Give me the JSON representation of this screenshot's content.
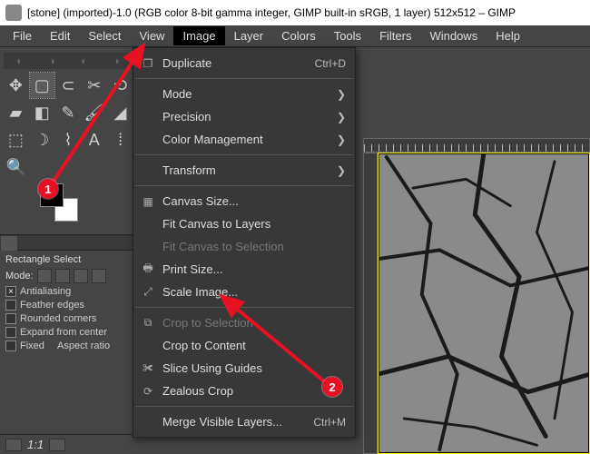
{
  "titlebar": {
    "text": "[stone] (imported)-1.0 (RGB color 8-bit gamma integer, GIMP built-in sRGB, 1 layer) 512x512 – GIMP"
  },
  "menubar": {
    "items": [
      "File",
      "Edit",
      "Select",
      "View",
      "Image",
      "Layer",
      "Colors",
      "Tools",
      "Filters",
      "Windows",
      "Help"
    ],
    "active": "Image"
  },
  "toolopts": {
    "title": "Rectangle Select",
    "mode_label": "Mode:",
    "antialiasing": "Antialiasing",
    "feather": "Feather edges",
    "rounded": "Rounded corners",
    "expand": "Expand from center",
    "fixed": "Fixed",
    "fixed_value": "Aspect ratio"
  },
  "status": {
    "zoom": "1:1"
  },
  "dropdown": {
    "duplicate": "Duplicate",
    "duplicate_accel": "Ctrl+D",
    "mode": "Mode",
    "precision": "Precision",
    "color_mgmt": "Color Management",
    "transform": "Transform",
    "canvas_size": "Canvas Size...",
    "fit_layers": "Fit Canvas to Layers",
    "fit_sel": "Fit Canvas to Selection",
    "print_size": "Print Size...",
    "scale": "Scale Image...",
    "crop_sel": "Crop to Selection",
    "crop_content": "Crop to Content",
    "slice": "Slice Using Guides",
    "zealous": "Zealous Crop",
    "merge": "Merge Visible Layers...",
    "merge_accel": "Ctrl+M"
  },
  "annotations": {
    "a1": "1",
    "a2": "2"
  }
}
